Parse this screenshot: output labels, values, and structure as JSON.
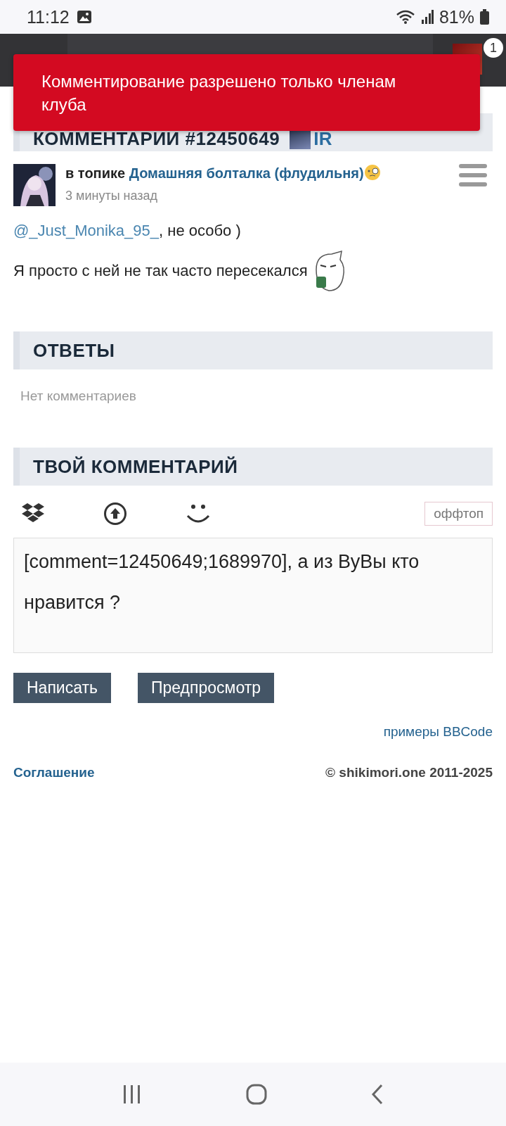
{
  "status_bar": {
    "time": "11:12",
    "battery": "81%"
  },
  "header": {
    "badge": "1"
  },
  "toast": {
    "message": "Комментирование разрешено только членам клуба"
  },
  "comment_section": {
    "title": "КОММЕНТАРИИ #12450649",
    "user_tag": "IR",
    "comment": {
      "prefix": "в топике",
      "topic": "Домашняя болталка (флудильня)",
      "time": "3 минуты назад",
      "mention": "@_Just_Monika_95_",
      "mention_rest": ", не особо )",
      "text": "Я просто с ней не так часто пересекался"
    }
  },
  "replies": {
    "title": "ОТВЕТЫ",
    "empty": "Нет комментариев"
  },
  "your_comment": {
    "title": "ТВОЙ КОММЕНТАРИЙ",
    "offtopic": {
      "label": "оффтоп",
      "selected": false
    },
    "value": "[comment=12450649;1689970], а из ВуВы кто нравится ?",
    "buttons": [
      {
        "label": "Написать"
      },
      {
        "label": "Предпросмотр"
      }
    ],
    "bbcode_link": "примеры BBCode"
  },
  "footer": {
    "agreement": "Соглашение",
    "copyright": "© shikimori.one 2011-2025"
  }
}
